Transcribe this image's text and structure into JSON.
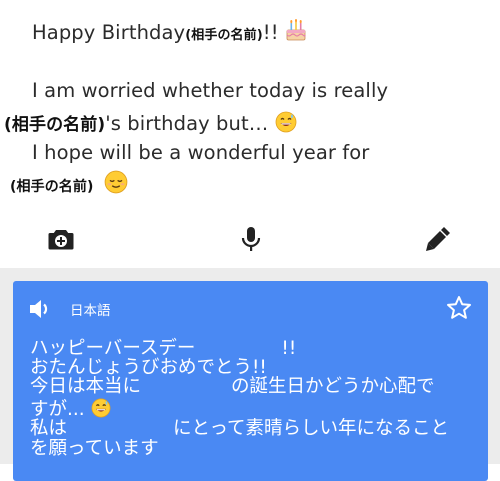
{
  "source": {
    "line1_text": "Happy Birthday",
    "line1_name": "(相手の名前)",
    "line1_suffix": "!!",
    "line2_text": "I am worried whether today is really",
    "line3_name": "(相手の名前)",
    "line3_text": "'s birthday but…",
    "line4_text": "I hope will be a wonderful year for",
    "line5_name": "(相手の名前)",
    "emoji_cake": "cake-emoji",
    "emoji_sweat": "sweat-smile-emoji",
    "emoji_relieved": "relieved-emoji"
  },
  "toolbar": {
    "camera_icon": "camera-icon",
    "mic_icon": "microphone-icon",
    "pen_icon": "handwriting-pen-icon"
  },
  "translation": {
    "language": "日本語",
    "line1_a": "ハッピーバースデー",
    "line1_b": "!!",
    "line2": "おたんじょうびおめでとう!!",
    "line3_a": "今日は本当に",
    "line3_b": "の誕生日かどうか心配で",
    "line4": "すが...",
    "line5_a": "私は",
    "line5_b": "にとって素晴らしい年になること",
    "line6": "を願っています"
  },
  "colors": {
    "card": "#4a89f3",
    "panel_bg": "#ececec",
    "icon": "#222222"
  }
}
